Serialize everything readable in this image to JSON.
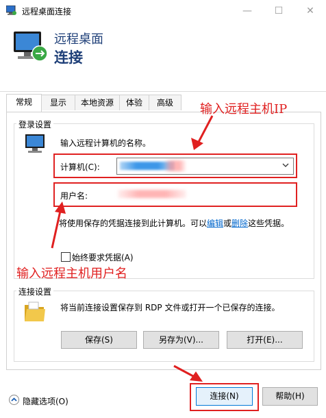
{
  "window": {
    "title": "远程桌面连接"
  },
  "header": {
    "line1": "远程桌面",
    "line2": "连接"
  },
  "tabs": [
    {
      "label": "常规"
    },
    {
      "label": "显示"
    },
    {
      "label": "本地资源"
    },
    {
      "label": "体验"
    },
    {
      "label": "高级"
    }
  ],
  "login": {
    "group_title": "登录设置",
    "instruction": "输入远程计算机的名称。",
    "computer_label": "计算机(C):",
    "username_label": "用户名:",
    "note_pre": "将使用保存的凭据连接到此计算机。可以",
    "note_edit": "编辑",
    "note_or": "或",
    "note_delete": "删除",
    "note_post": "这些凭据。",
    "always_ask_label": "始终要求凭据(A)"
  },
  "connection": {
    "group_title": "连接设置",
    "description": "将当前连接设置保存到 RDP 文件或打开一个已保存的连接。",
    "save_label": "保存(S)",
    "save_as_label": "另存为(V)...",
    "open_label": "打开(E)..."
  },
  "footer": {
    "hide_options_label": "隐藏选项(O)",
    "connect_label": "连接(N)",
    "help_label": "帮助(H)"
  },
  "annotations": {
    "ip_hint": "输入远程主机IP",
    "user_hint": "输入远程主机用户名"
  },
  "colors": {
    "annotation": "#e02020",
    "header_text": "#1e3f78",
    "accent": "#0078d7"
  }
}
